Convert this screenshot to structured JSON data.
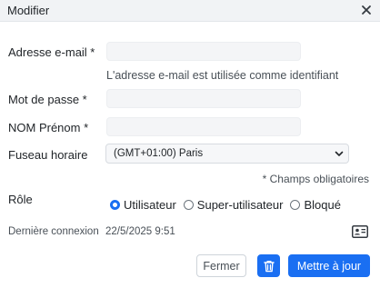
{
  "dialog": {
    "title": "Modifier",
    "close_icon": "close-icon"
  },
  "form": {
    "email": {
      "label": "Adresse e-mail *",
      "value": "",
      "help": "L'adresse e-mail est utilisée comme identifiant"
    },
    "password": {
      "label": "Mot de passe *",
      "value": ""
    },
    "fullname": {
      "label": "NOM Prénom *",
      "value": ""
    },
    "timezone": {
      "label": "Fuseau horaire",
      "selected": "(GMT+01:00) Paris"
    },
    "required_note": "* Champs obligatoires",
    "role": {
      "label": "Rôle",
      "options": [
        {
          "label": "Utilisateur",
          "checked": true
        },
        {
          "label": "Super-utilisateur",
          "checked": false
        },
        {
          "label": "Bloqué",
          "checked": false
        }
      ]
    },
    "last_login": {
      "label": "Dernière connexion",
      "value": "22/5/2025 9:51"
    }
  },
  "actions": {
    "close_label": "Fermer",
    "delete_icon": "trash-icon",
    "update_label": "Mettre à jour"
  },
  "colors": {
    "accent": "#1a6ff2",
    "header_bg": "#f1f3f5"
  }
}
